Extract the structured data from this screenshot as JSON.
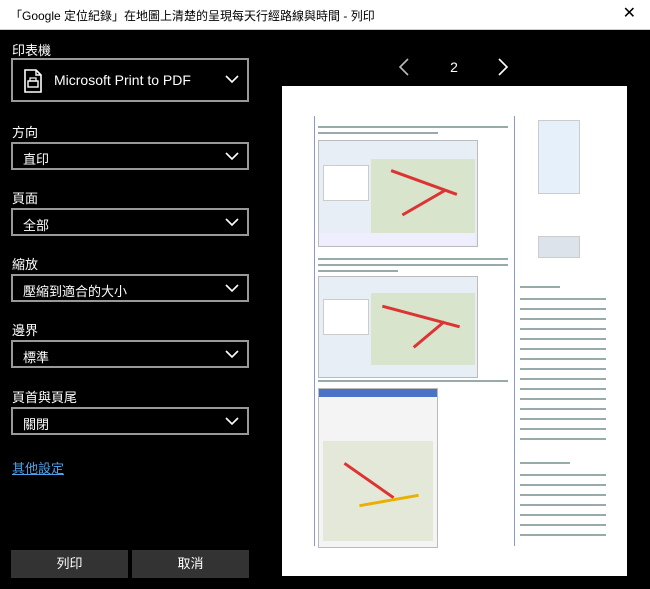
{
  "window": {
    "title": "「Google 定位紀錄」在地圖上清楚的呈現每天行經路線與時間 - 列印",
    "close_glyph": "✕"
  },
  "printer": {
    "label": "印表機",
    "value": "Microsoft Print to PDF"
  },
  "orientation": {
    "label": "方向",
    "value": "直印"
  },
  "pages": {
    "label": "頁面",
    "value": "全部"
  },
  "scale": {
    "label": "縮放",
    "value": "壓縮到適合的大小"
  },
  "margins": {
    "label": "邊界",
    "value": "標準"
  },
  "headers": {
    "label": "頁首與頁尾",
    "value": "關閉"
  },
  "more_settings": "其他設定",
  "buttons": {
    "print": "列印",
    "cancel": "取消"
  },
  "preview": {
    "page": "2"
  },
  "colors": {
    "accent_link": "#4ea1e8",
    "background": "#000000",
    "button": "#333333"
  }
}
